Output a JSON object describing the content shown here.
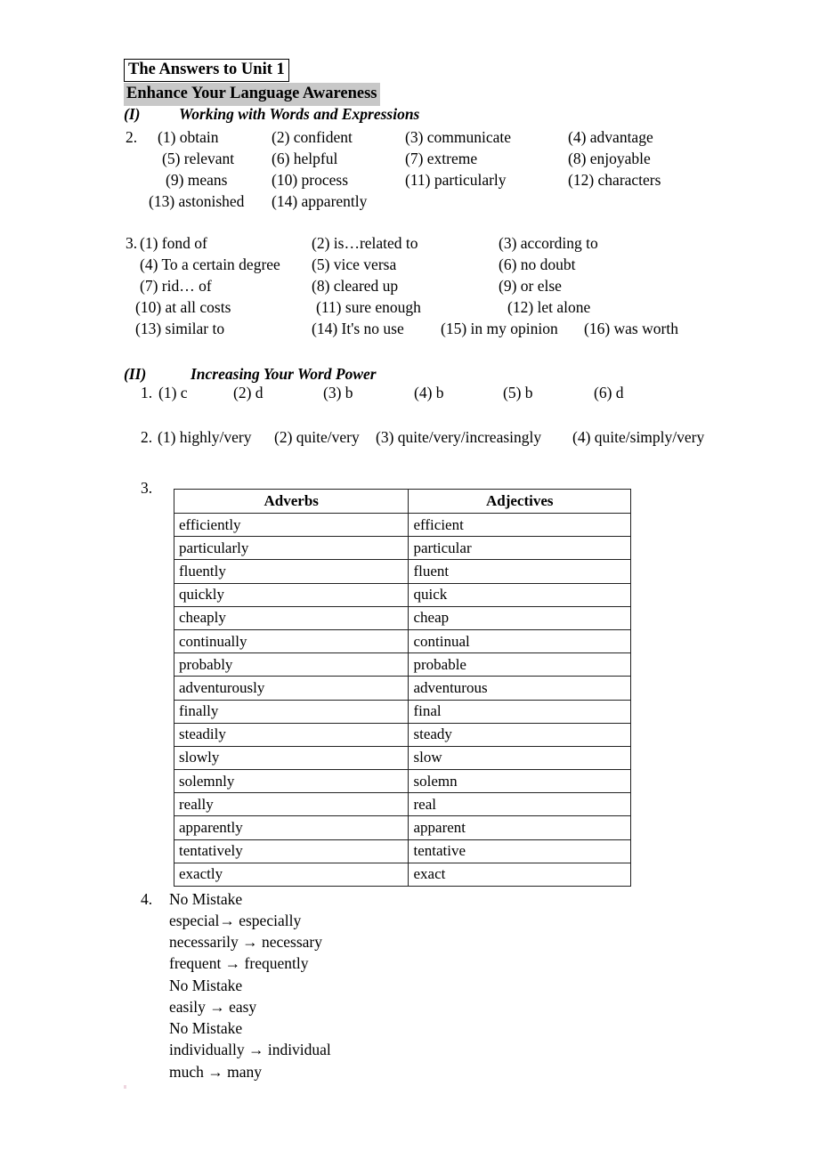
{
  "document": {
    "title_boxed": "The Answers to Unit 1",
    "highlighted_heading": "Enhance Your Language Awareness"
  },
  "section_1": {
    "numeral": "(I)",
    "label": "Working with Words and Expressions",
    "exercise_2": {
      "number": "2.",
      "items": [
        "(1) obtain",
        "(2) confident",
        "(3) communicate",
        "(4) advantage",
        "(5) relevant",
        "(6) helpful",
        "(7) extreme",
        "(8) enjoyable",
        "(9) means",
        "(10) process",
        "(11) particularly",
        "(12) characters",
        "(13) astonished",
        "(14) apparently"
      ]
    },
    "exercise_3": {
      "number": "3.",
      "items": [
        "(1) fond of",
        "(2) is…related to",
        "(3) according to",
        "(4) To a certain degree",
        "(5) vice versa",
        "(6) no doubt",
        "(7) rid… of",
        "(8) cleared up",
        "(9) or else",
        "(10) at all costs",
        "(11) sure enough",
        "(12) let alone",
        "(13) similar to",
        "(14) It's no use",
        "(15) in my opinion",
        "(16) was worth"
      ]
    }
  },
  "section_2": {
    "numeral": "(II)",
    "label": "Increasing Your Word Power",
    "exercise_1": {
      "number": "1.",
      "items": [
        "(1) c",
        "(2) d",
        "(3) b",
        "(4) b",
        "(5) b",
        "(6) d"
      ]
    },
    "exercise_2": {
      "number": "2.",
      "items": [
        "(1) highly/very",
        "(2) quite/very",
        "(3) quite/very/increasingly",
        "(4) quite/simply/very"
      ]
    },
    "exercise_3": {
      "number": "3.",
      "table": {
        "headers": [
          "Adverbs",
          "Adjectives"
        ],
        "rows": [
          [
            "efficiently",
            "efficient"
          ],
          [
            "particularly",
            "particular"
          ],
          [
            "fluently",
            "fluent"
          ],
          [
            "quickly",
            "quick"
          ],
          [
            "cheaply",
            "cheap"
          ],
          [
            "continually",
            "continual"
          ],
          [
            "probably",
            "probable"
          ],
          [
            "adventurously",
            "adventurous"
          ],
          [
            "finally",
            "final"
          ],
          [
            "steadily",
            "steady"
          ],
          [
            "slowly",
            "slow"
          ],
          [
            "solemnly",
            "solemn"
          ],
          [
            "really",
            "real"
          ],
          [
            "apparently",
            "apparent"
          ],
          [
            "tentatively",
            "tentative"
          ],
          [
            "exactly",
            "exact"
          ]
        ]
      }
    },
    "exercise_4": {
      "number": "4.",
      "lines": [
        "No Mistake",
        "especial→  especially",
        "necessarily  →  necessary",
        "frequent → frequently",
        "No Mistake",
        "easily → easy",
        "No Mistake",
        "individually → individual",
        "much → many"
      ]
    }
  }
}
